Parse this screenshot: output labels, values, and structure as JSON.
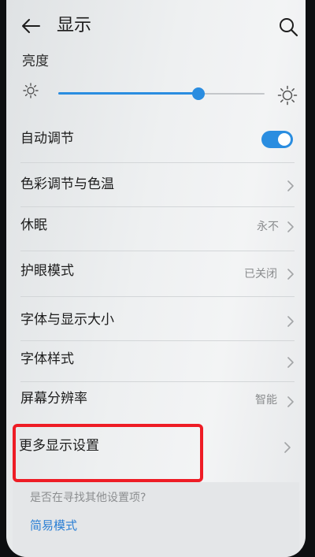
{
  "header": {
    "title": "显示"
  },
  "brightness": {
    "label": "亮度",
    "level_percent": 68
  },
  "auto_adjust": {
    "label": "自动调节",
    "enabled": true
  },
  "rows": [
    {
      "label": "色彩调节与色温",
      "value": ""
    },
    {
      "label": "休眠",
      "value": "永不"
    },
    {
      "label": "护眼模式",
      "value": "已关闭"
    },
    {
      "label": "字体与显示大小",
      "value": ""
    },
    {
      "label": "字体样式",
      "value": ""
    },
    {
      "label": "屏幕分辨率",
      "value": "智能"
    },
    {
      "label": "更多显示设置",
      "value": ""
    }
  ],
  "suggestion": {
    "question": "是否在寻找其他设置项?",
    "link": "简易模式"
  },
  "colors": {
    "accent": "#2a8de0",
    "highlight_frame": "#ee1c25",
    "link": "#2a7fd4"
  },
  "icons": {
    "back": "arrow-left-icon",
    "search": "search-icon",
    "brightness_low": "sun-small-icon",
    "brightness_high": "sun-large-icon",
    "row_arrow": "chevron-right-icon"
  }
}
